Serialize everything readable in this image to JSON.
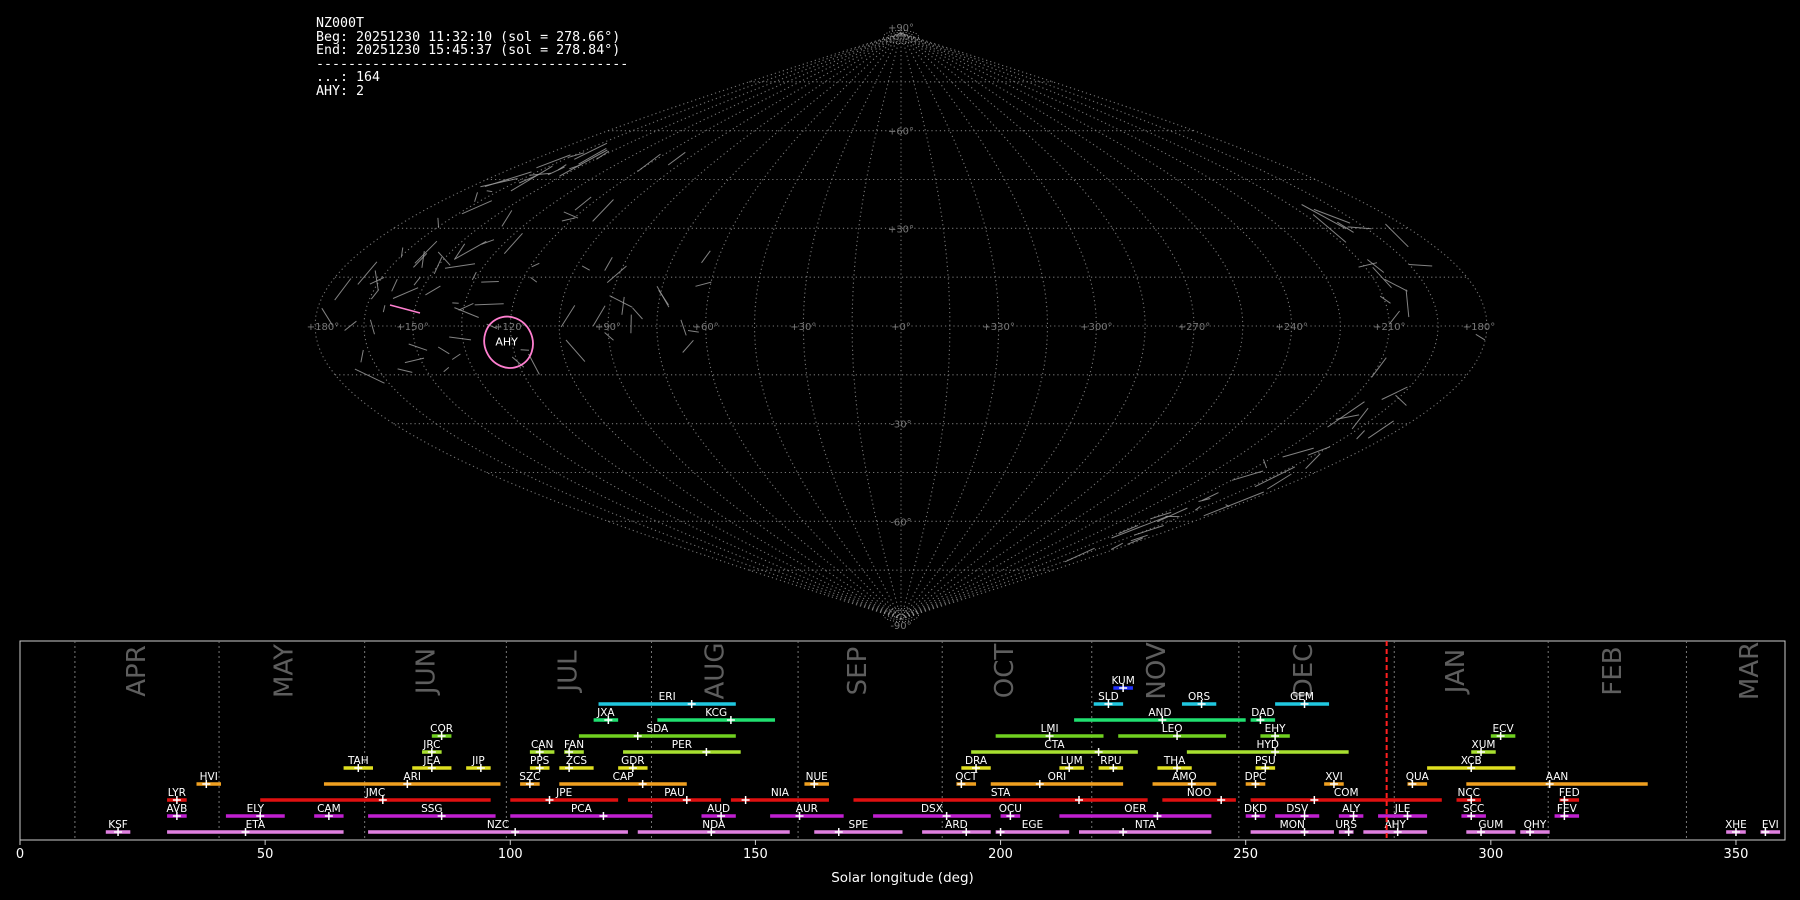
{
  "info": {
    "station": "NZ000T",
    "begin": "Beg: 20251230 11:32:10 (sol = 278.66°)",
    "end": "End: 20251230 15:45:37 (sol = 278.84°)",
    "separator": "---------------------------------------",
    "counts": [
      {
        "label": "...",
        "value": 164
      },
      {
        "label": "AHY",
        "value": 2
      }
    ]
  },
  "sky_map": {
    "projection": "sinusoidal",
    "lon_labels": [
      "+180°",
      "+150°",
      "+120°",
      "+90°",
      "+60°",
      "+30°",
      "+0°",
      "+330°",
      "+300°",
      "+270°",
      "+240°",
      "+210°",
      "+180°"
    ],
    "lat_labels": [
      "+90°",
      "+60°",
      "+30°",
      "+0°",
      "-30°",
      "-60°",
      "-90°"
    ],
    "grid": true,
    "highlight": {
      "shower": "AHY",
      "color": "#ff7fd0"
    },
    "trails_color": "#9a9a9a"
  },
  "chart_data": {
    "type": "timeline",
    "xlabel": "Solar longitude (deg)",
    "xlim": [
      0,
      360
    ],
    "xticks": [
      0,
      50,
      100,
      150,
      200,
      250,
      300,
      350
    ],
    "current_sol": 278.75,
    "current_sol_color": "#ff2020",
    "months": [
      {
        "name": "APR",
        "start": 11.2,
        "center": 24
      },
      {
        "name": "MAY",
        "start": 40.6,
        "center": 54
      },
      {
        "name": "JUN",
        "start": 70.3,
        "center": 83
      },
      {
        "name": "JUL",
        "start": 99.2,
        "center": 112
      },
      {
        "name": "AUG",
        "start": 128.8,
        "center": 142
      },
      {
        "name": "SEP",
        "start": 158.7,
        "center": 171
      },
      {
        "name": "OCT",
        "start": 188.1,
        "center": 201
      },
      {
        "name": "NOV",
        "start": 218.6,
        "center": 232
      },
      {
        "name": "DEC",
        "start": 248.6,
        "center": 262
      },
      {
        "name": "JAN",
        "start": 280.3,
        "center": 293
      },
      {
        "name": "FEB",
        "start": 311.7,
        "center": 325
      },
      {
        "name": "MAR",
        "start": 339.9,
        "center": 353
      }
    ],
    "showers": [
      {
        "code": "KSF",
        "start": 17.5,
        "end": 22.5,
        "peak": 20,
        "row": 0,
        "color": "#e080e0"
      },
      {
        "code": "ETA",
        "start": 30,
        "end": 66,
        "peak": 46,
        "row": 0,
        "color": "#e080e0"
      },
      {
        "code": "NZC",
        "start": 71,
        "end": 124,
        "peak": 101,
        "row": 0,
        "color": "#e080e0"
      },
      {
        "code": "NDA",
        "start": 126,
        "end": 157,
        "peak": 141,
        "row": 0,
        "color": "#e080e0"
      },
      {
        "code": "SPE",
        "start": 162,
        "end": 180,
        "peak": 167,
        "row": 0,
        "color": "#e080e0"
      },
      {
        "code": "ARD",
        "start": 184,
        "end": 198,
        "peak": 193,
        "row": 0,
        "color": "#e080e0"
      },
      {
        "code": "EGE",
        "start": 199,
        "end": 214,
        "peak": 200,
        "row": 0,
        "color": "#e080e0"
      },
      {
        "code": "NTA",
        "start": 216,
        "end": 243,
        "peak": 225,
        "row": 0,
        "color": "#e080e0"
      },
      {
        "code": "MON",
        "start": 251,
        "end": 268,
        "peak": 262,
        "row": 0,
        "color": "#e080e0"
      },
      {
        "code": "URS",
        "start": 269,
        "end": 272,
        "peak": 271,
        "row": 0,
        "color": "#e080e0"
      },
      {
        "code": "AHY",
        "start": 274,
        "end": 287,
        "peak": 281,
        "row": 0,
        "color": "#e080e0"
      },
      {
        "code": "GUM",
        "start": 295,
        "end": 305,
        "peak": 298,
        "row": 0,
        "color": "#e080e0"
      },
      {
        "code": "OHY",
        "start": 306,
        "end": 312,
        "peak": 308,
        "row": 0,
        "color": "#e080e0"
      },
      {
        "code": "XHE",
        "start": 348,
        "end": 352,
        "peak": 350,
        "row": 0,
        "color": "#e080e0"
      },
      {
        "code": "EVI",
        "start": 355,
        "end": 359,
        "peak": 356,
        "row": 0,
        "color": "#e080e0"
      },
      {
        "code": "AVB",
        "start": 30,
        "end": 34,
        "peak": 32,
        "row": 1,
        "color": "#c020d0"
      },
      {
        "code": "ELY",
        "start": 42,
        "end": 54,
        "peak": 49,
        "row": 1,
        "color": "#c020d0"
      },
      {
        "code": "CAM",
        "start": 60,
        "end": 66,
        "peak": 63,
        "row": 1,
        "color": "#c020d0"
      },
      {
        "code": "SSG",
        "start": 71,
        "end": 97,
        "peak": 86,
        "row": 1,
        "color": "#c020d0"
      },
      {
        "code": "PCA",
        "start": 100,
        "end": 129,
        "peak": 119,
        "row": 1,
        "color": "#c020d0"
      },
      {
        "code": "AUD",
        "start": 139,
        "end": 146,
        "peak": 143,
        "row": 1,
        "color": "#c020d0"
      },
      {
        "code": "AUR",
        "start": 153,
        "end": 168,
        "peak": 159,
        "row": 1,
        "color": "#c020d0"
      },
      {
        "code": "DSX",
        "start": 174,
        "end": 198,
        "peak": 189,
        "row": 1,
        "color": "#c020d0"
      },
      {
        "code": "OCU",
        "start": 200,
        "end": 204,
        "peak": 202,
        "row": 1,
        "color": "#c020d0"
      },
      {
        "code": "OER",
        "start": 212,
        "end": 243,
        "peak": 232,
        "row": 1,
        "color": "#c020d0"
      },
      {
        "code": "DKD",
        "start": 250,
        "end": 254,
        "peak": 252,
        "row": 1,
        "color": "#c020d0"
      },
      {
        "code": "DSV",
        "start": 256,
        "end": 265,
        "peak": 262,
        "row": 1,
        "color": "#c020d0"
      },
      {
        "code": "ALY",
        "start": 269,
        "end": 274,
        "peak": 272,
        "row": 1,
        "color": "#c020d0"
      },
      {
        "code": "JLE",
        "start": 277,
        "end": 287,
        "peak": 283,
        "row": 1,
        "color": "#c020d0"
      },
      {
        "code": "SCC",
        "start": 294,
        "end": 299,
        "peak": 296,
        "row": 1,
        "color": "#c020d0"
      },
      {
        "code": "FEV",
        "start": 313,
        "end": 318,
        "peak": 315,
        "row": 1,
        "color": "#c020d0"
      },
      {
        "code": "LYR",
        "start": 30,
        "end": 34,
        "peak": 32,
        "row": 2,
        "color": "#e01010"
      },
      {
        "code": "JMC",
        "start": 49,
        "end": 96,
        "peak": 74,
        "row": 2,
        "color": "#e01010"
      },
      {
        "code": "JPE",
        "start": 100,
        "end": 122,
        "peak": 108,
        "row": 2,
        "color": "#e01010"
      },
      {
        "code": "PAU",
        "start": 124,
        "end": 143,
        "peak": 136,
        "row": 2,
        "color": "#e01010"
      },
      {
        "code": "NIA",
        "start": 145,
        "end": 165,
        "peak": 148,
        "row": 2,
        "color": "#e01010"
      },
      {
        "code": "STA",
        "start": 170,
        "end": 230,
        "peak": 216,
        "row": 2,
        "color": "#e01010"
      },
      {
        "code": "NOO",
        "start": 233,
        "end": 248,
        "peak": 245,
        "row": 2,
        "color": "#e01010"
      },
      {
        "code": "COM",
        "start": 251,
        "end": 290,
        "peak": 264,
        "row": 2,
        "color": "#e01010"
      },
      {
        "code": "NCC",
        "start": 293,
        "end": 298,
        "peak": 296,
        "row": 2,
        "color": "#e01010"
      },
      {
        "code": "FED",
        "start": 314,
        "end": 318,
        "peak": 315,
        "row": 2,
        "color": "#e01010"
      },
      {
        "code": "HVI",
        "start": 36,
        "end": 41,
        "peak": 38,
        "row": 3,
        "color": "#f0a020"
      },
      {
        "code": "ARI",
        "start": 62,
        "end": 98,
        "peak": 79,
        "row": 3,
        "color": "#f0a020"
      },
      {
        "code": "SZC",
        "start": 102,
        "end": 106,
        "peak": 104,
        "row": 3,
        "color": "#f0a020"
      },
      {
        "code": "CAP",
        "start": 110,
        "end": 136,
        "peak": 127,
        "row": 3,
        "color": "#f0a020"
      },
      {
        "code": "NUE",
        "start": 160,
        "end": 165,
        "peak": 162,
        "row": 3,
        "color": "#f0a020"
      },
      {
        "code": "OCT",
        "start": 191,
        "end": 195,
        "peak": 192,
        "row": 3,
        "color": "#f0a020"
      },
      {
        "code": "ORI",
        "start": 198,
        "end": 225,
        "peak": 208,
        "row": 3,
        "color": "#f0a020"
      },
      {
        "code": "AMO",
        "start": 231,
        "end": 244,
        "peak": 239,
        "row": 3,
        "color": "#f0a020"
      },
      {
        "code": "DPC",
        "start": 250,
        "end": 254,
        "peak": 252,
        "row": 3,
        "color": "#f0a020"
      },
      {
        "code": "XVI",
        "start": 266,
        "end": 270,
        "peak": 268,
        "row": 3,
        "color": "#f0a020"
      },
      {
        "code": "QUA",
        "start": 283,
        "end": 287,
        "peak": 284,
        "row": 3,
        "color": "#f0a020"
      },
      {
        "code": "AAN",
        "start": 295,
        "end": 332,
        "peak": 312,
        "row": 3,
        "color": "#f0a020"
      },
      {
        "code": "TAH",
        "start": 66,
        "end": 72,
        "peak": 69,
        "row": 4,
        "color": "#e0e020"
      },
      {
        "code": "JEA",
        "start": 80,
        "end": 88,
        "peak": 84,
        "row": 4,
        "color": "#e0e020"
      },
      {
        "code": "JIP",
        "start": 91,
        "end": 96,
        "peak": 94,
        "row": 4,
        "color": "#e0e020"
      },
      {
        "code": "PPS",
        "start": 104,
        "end": 108,
        "peak": 106,
        "row": 4,
        "color": "#e0e020"
      },
      {
        "code": "ZCS",
        "start": 110,
        "end": 117,
        "peak": 112,
        "row": 4,
        "color": "#e0e020"
      },
      {
        "code": "GDR",
        "start": 122,
        "end": 128,
        "peak": 125,
        "row": 4,
        "color": "#e0e020"
      },
      {
        "code": "DRA",
        "start": 192,
        "end": 198,
        "peak": 195,
        "row": 4,
        "color": "#e0e020"
      },
      {
        "code": "LUM",
        "start": 212,
        "end": 217,
        "peak": 214,
        "row": 4,
        "color": "#e0e020"
      },
      {
        "code": "RPU",
        "start": 220,
        "end": 225,
        "peak": 223,
        "row": 4,
        "color": "#e0e020"
      },
      {
        "code": "THA",
        "start": 232,
        "end": 239,
        "peak": 236,
        "row": 4,
        "color": "#e0e020"
      },
      {
        "code": "PSU",
        "start": 252,
        "end": 256,
        "peak": 254,
        "row": 4,
        "color": "#e0e020"
      },
      {
        "code": "XCB",
        "start": 287,
        "end": 305,
        "peak": 296,
        "row": 4,
        "color": "#e0e020"
      },
      {
        "code": "JRC",
        "start": 82,
        "end": 86,
        "peak": 84,
        "row": 5,
        "color": "#a8e030"
      },
      {
        "code": "CAN",
        "start": 104,
        "end": 109,
        "peak": 106,
        "row": 5,
        "color": "#a8e030"
      },
      {
        "code": "FAN",
        "start": 111,
        "end": 115,
        "peak": 112,
        "row": 5,
        "color": "#a8e030"
      },
      {
        "code": "PER",
        "start": 123,
        "end": 147,
        "peak": 140,
        "row": 5,
        "color": "#a8e030"
      },
      {
        "code": "CTA",
        "start": 194,
        "end": 228,
        "peak": 220,
        "row": 5,
        "color": "#a8e030"
      },
      {
        "code": "HYD",
        "start": 238,
        "end": 271,
        "peak": 256,
        "row": 5,
        "color": "#a8e030"
      },
      {
        "code": "XUM",
        "start": 296,
        "end": 301,
        "peak": 298,
        "row": 5,
        "color": "#a8e030"
      },
      {
        "code": "COR",
        "start": 84,
        "end": 88,
        "peak": 86,
        "row": 6,
        "color": "#70d020"
      },
      {
        "code": "SDA",
        "start": 114,
        "end": 146,
        "peak": 126,
        "row": 6,
        "color": "#70d020"
      },
      {
        "code": "LMI",
        "start": 199,
        "end": 221,
        "peak": 210,
        "row": 6,
        "color": "#70d020"
      },
      {
        "code": "LEO",
        "start": 224,
        "end": 246,
        "peak": 236,
        "row": 6,
        "color": "#70d020"
      },
      {
        "code": "EHY",
        "start": 253,
        "end": 259,
        "peak": 256,
        "row": 6,
        "color": "#70d020"
      },
      {
        "code": "ECV",
        "start": 300,
        "end": 305,
        "peak": 302,
        "row": 6,
        "color": "#70d020"
      },
      {
        "code": "JXA",
        "start": 117,
        "end": 122,
        "peak": 120,
        "row": 7,
        "color": "#20e070"
      },
      {
        "code": "KCG",
        "start": 130,
        "end": 154,
        "peak": 145,
        "row": 7,
        "color": "#20e070"
      },
      {
        "code": "AND",
        "start": 215,
        "end": 250,
        "peak": 233,
        "row": 7,
        "color": "#20e070"
      },
      {
        "code": "DAD",
        "start": 251,
        "end": 256,
        "peak": 253,
        "row": 7,
        "color": "#20e070"
      },
      {
        "code": "ERI",
        "start": 118,
        "end": 146,
        "peak": 137,
        "row": 8,
        "color": "#20c8e0"
      },
      {
        "code": "SLD",
        "start": 219,
        "end": 225,
        "peak": 222,
        "row": 8,
        "color": "#20c8e0"
      },
      {
        "code": "ORS",
        "start": 237,
        "end": 244,
        "peak": 241,
        "row": 8,
        "color": "#20c8e0"
      },
      {
        "code": "GEM",
        "start": 256,
        "end": 267,
        "peak": 262,
        "row": 8,
        "color": "#20c8e0"
      },
      {
        "code": "KUM",
        "start": 223,
        "end": 227,
        "peak": 225,
        "row": 9,
        "color": "#2030ff"
      }
    ]
  }
}
